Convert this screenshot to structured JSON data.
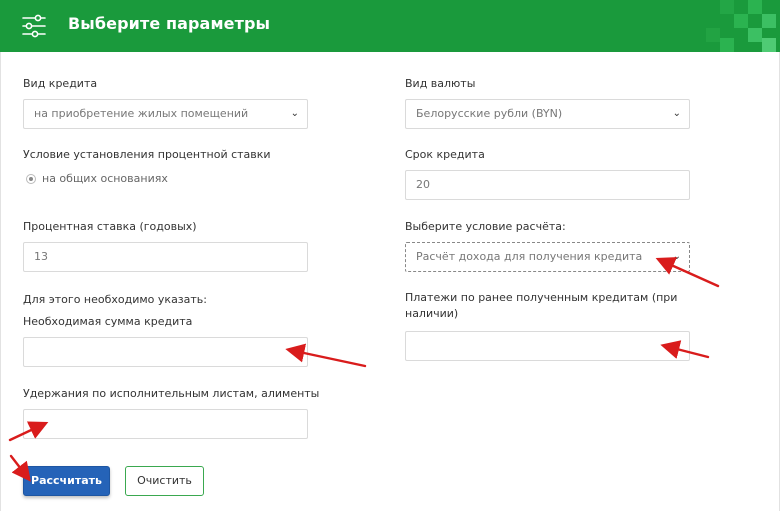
{
  "header": {
    "title": "Выберите параметры",
    "background_color": "#1a9a3c",
    "icon": "sliders-icon"
  },
  "form": {
    "credit_type": {
      "label": "Вид кредита",
      "value": "на приобретение жилых помещений"
    },
    "currency": {
      "label": "Вид валюты",
      "value": "Белорусские рубли (BYN)"
    },
    "rate_condition": {
      "label": "Условие установления процентной ставки",
      "option": "на общих основаниях",
      "selected": true
    },
    "term": {
      "label": "Срок кредита",
      "value": "20"
    },
    "rate": {
      "label": "Процентная ставка (годовых)",
      "value": "13"
    },
    "calc_condition": {
      "label": "Выберите условие расчёта:",
      "value": "Расчёт дохода для получения кредита"
    },
    "required_note": "Для этого необходимо указать:",
    "loan_amount": {
      "label": "Необходимая сумма кредита",
      "value": ""
    },
    "previous_payments": {
      "label": "Платежи по ранее полученным  кредитам (при наличии)",
      "value": ""
    },
    "deductions": {
      "label": "Удержания по исполнительным листам, алименты",
      "value": ""
    }
  },
  "buttons": {
    "calculate": "Рассчитать",
    "clear": "Очистить",
    "primary_color": "#2563b8",
    "secondary_border_color": "#3aa84f"
  },
  "annotations": {
    "arrow_color": "#d91c1c"
  }
}
